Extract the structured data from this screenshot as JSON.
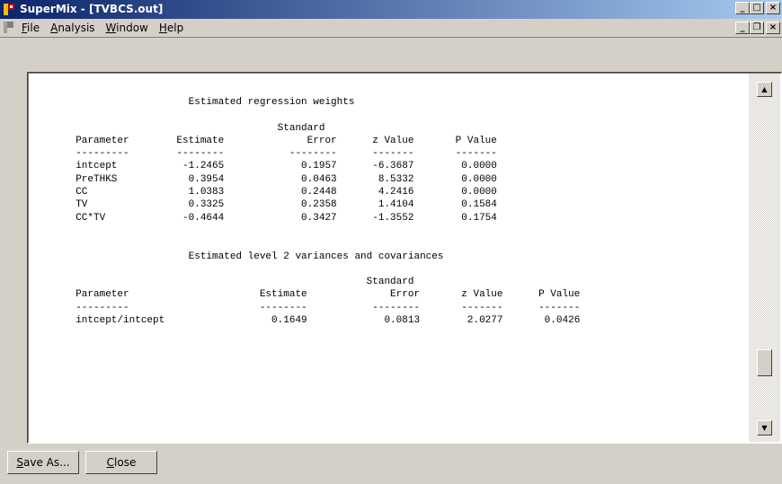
{
  "window": {
    "title": "SuperMix - [TVBCS.out]",
    "controls": {
      "minimize": "_",
      "maximize": "□",
      "close": "×"
    }
  },
  "menubar": {
    "items": [
      {
        "label": "File",
        "mnemonic": "F"
      },
      {
        "label": "Analysis",
        "mnemonic": "A"
      },
      {
        "label": "Window",
        "mnemonic": "W"
      },
      {
        "label": "Help",
        "mnemonic": "H"
      }
    ],
    "mdi_controls": {
      "minimize": "_",
      "restore": "❐",
      "close": "×"
    }
  },
  "report": {
    "text": "                     Estimated regression weights\n\n                                    Standard\n  Parameter        Estimate              Error      z Value       P Value\n  ---------        --------           --------      -------       -------\n  intcept           -1.2465             0.1957      -6.3687        0.0000\n  PreTHKS            0.3954             0.0463       8.5332        0.0000\n  CC                 1.0383             0.2448       4.2416        0.0000\n  TV                 0.3325             0.2358       1.4104        0.1584\n  CC*TV             -0.4644             0.3427      -1.3552        0.1754\n\n\n                     Estimated level 2 variances and covariances\n\n                                                   Standard\n  Parameter                      Estimate              Error       z Value      P Value\n  ---------                      --------           --------       -------      -------\n  intcept/intcept                  0.1649             0.0813        2.0277       0.0426"
  },
  "scrollbar": {
    "up_arrow": "▲",
    "down_arrow": "▼"
  },
  "buttons": {
    "save_as": {
      "label": "Save As...",
      "mnemonic": "S"
    },
    "close": {
      "label": "Close",
      "mnemonic": "C"
    }
  }
}
